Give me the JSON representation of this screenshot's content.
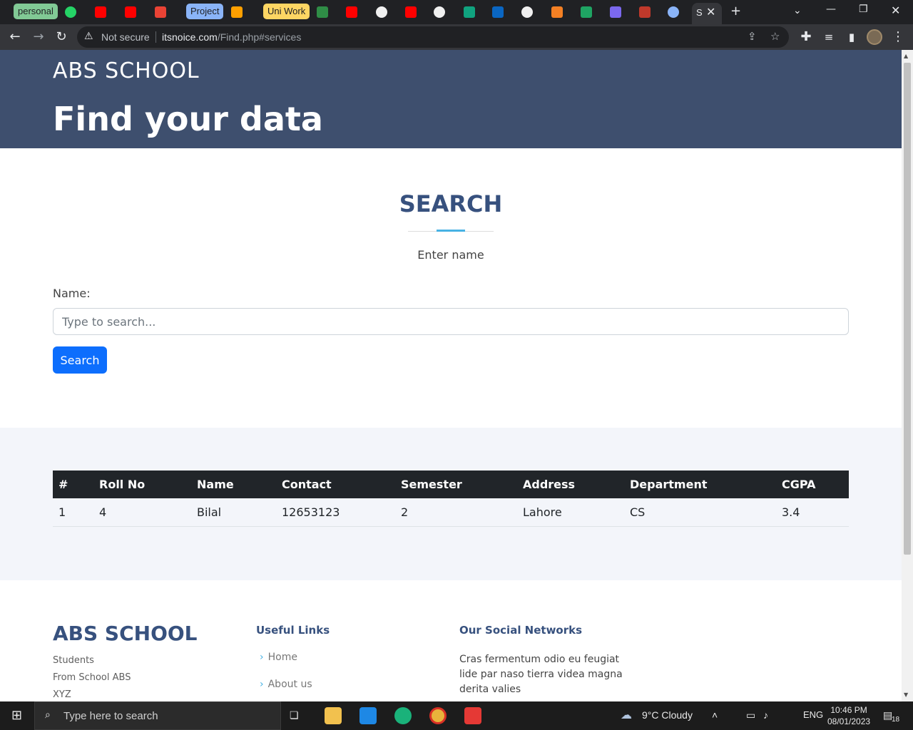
{
  "browser": {
    "tab_groups": [
      {
        "label": "personal",
        "color": "#81c995"
      },
      {
        "label": "Project",
        "color": "#8ab4f8"
      },
      {
        "label": "Uni Work",
        "color": "#fdd663"
      }
    ],
    "active_tab_label": "S",
    "url_security": "Not secure",
    "url_host": "itsnoice.com",
    "url_path": "/Find.php#services"
  },
  "header": {
    "logo": "ABS SCHOOL",
    "title": "Find your data"
  },
  "search_section": {
    "title": "SEARCH",
    "subtitle": "Enter name",
    "name_label": "Name:",
    "input_placeholder": "Type to search...",
    "input_value": "",
    "button_label": "Search"
  },
  "results_table": {
    "columns": [
      "#",
      "Roll No",
      "Name",
      "Contact",
      "Semester",
      "Address",
      "Department",
      "CGPA"
    ],
    "rows": [
      [
        "1",
        "4",
        "Bilal",
        "12653123",
        "2",
        "Lahore",
        "CS",
        "3.4"
      ]
    ]
  },
  "footer": {
    "logo": "ABS SCHOOL",
    "lines": [
      "Students",
      "From School ABS",
      "XYZ"
    ],
    "useful_links_heading": "Useful Links",
    "links": [
      "Home",
      "About us"
    ],
    "social_heading": "Our Social Networks",
    "social_text": "Cras fermentum odio eu feugiat lide par naso tierra videa magna derita valies"
  },
  "taskbar": {
    "search_placeholder": "Type here to search",
    "weather": "9°C  Cloudy",
    "language": "ENG",
    "time": "10:46 PM",
    "date": "08/01/2023",
    "notifications": "18"
  },
  "colors": {
    "hero_bg": "#3e4f6e",
    "accent_title": "#37517e",
    "primary_button": "#0d6efd",
    "accent_line": "#47b2e4"
  }
}
